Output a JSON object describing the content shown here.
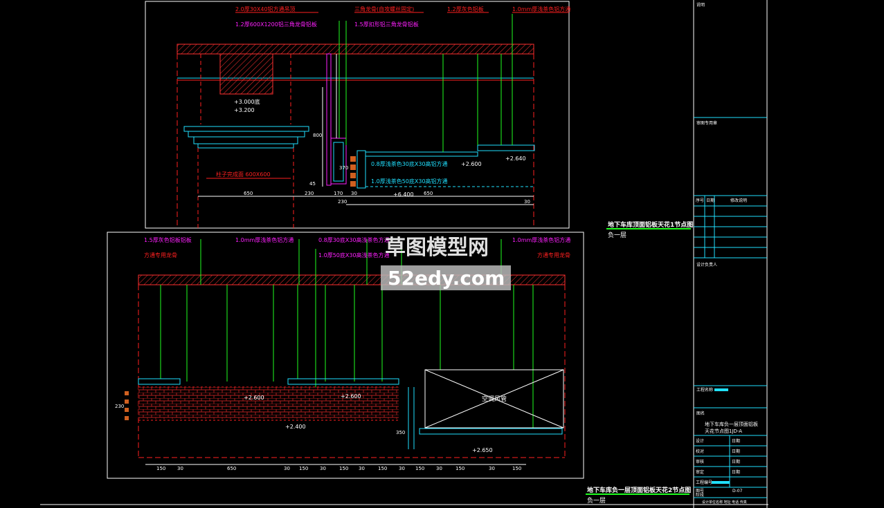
{
  "colors": {
    "background": "#000000",
    "frame": "#ffffff",
    "red": "#ff2020",
    "green": "#20ff20",
    "cyan": "#20e0ff",
    "magenta": "#ff20ff",
    "yellow": "#ffff20",
    "hatch": "#ff3030",
    "panel": "#20e0ff",
    "watermark_bg": "#cccccc"
  },
  "detail1": {
    "labels_top": [
      "2.0厚30X40铝方通吊顶",
      "1.2厚600X1200铝三角龙骨铝板",
      "三角龙骨(自攻螺丝固定)",
      "1.5厚扣形铝三角龙骨铝板",
      "1.2厚灰色铝板",
      "1.0mm厚浅茶色铝方通"
    ],
    "level_labels": [
      "+3.000底",
      "+3.200"
    ],
    "column_label": "柱子完成面 600X600",
    "right_labels": [
      "0.8厚浅茶色30底X30高铝方通",
      "1.0厚浅茶色50底X30高铝方通"
    ],
    "elevations": [
      "+2.600",
      "+2.640",
      "+6.400"
    ],
    "dims_bottom": [
      "650",
      "230",
      "170",
      "30",
      "650",
      "30",
      "230"
    ],
    "dim_vertical": [
      "800",
      "370",
      "45"
    ]
  },
  "detail2": {
    "labels_top": [
      "1.5厚灰色铝板铝板",
      "方通专用龙骨",
      "1.0mm厚浅茶色铝方通",
      "0.8厚30底X30高浅茶色方通",
      "1.0厚50底X30高浅茶色方通",
      "1.0mm厚浅茶色铝方通",
      "方通专用龙骨"
    ],
    "elevations": [
      "+2.600",
      "+2.600",
      "+2.400",
      "+2.650"
    ],
    "vent_label": "空调风管",
    "dims_bottom": [
      "150",
      "30",
      "650",
      "30",
      "150",
      "30",
      "150",
      "30",
      "150",
      "30",
      "150",
      "30",
      "150",
      "30",
      "150"
    ],
    "dim_vertical": [
      "230",
      "350"
    ]
  },
  "titles": {
    "detail1_title": "地下车库顶面铝板天花1节点图",
    "detail1_sub": "负一层",
    "detail2_title": "地下车库负一层顶面铝板天花2节点图",
    "detail2_sub": "负一层"
  },
  "title_block": {
    "header": "说明",
    "stamp": "审图专用章",
    "revision_cols": [
      "序号",
      "日期",
      "修改说明"
    ],
    "signature": "设计负责人",
    "project_label": "工程名称",
    "drawing_label": "图名",
    "drawing_name_line1": "地下车库负一层顶面铝板",
    "drawing_name_line2": "天花节点图1JD-A",
    "roles": [
      "设计",
      "校对",
      "审核",
      "审定"
    ],
    "date_label": "日期",
    "project_no_label": "工程编号",
    "sheet_label": "图号",
    "sheet_no": "D-07",
    "phase_label": "阶段",
    "footer": "设计单位名称 地址 电话 传真"
  },
  "watermark": {
    "line1": "草图模型网",
    "line2": "52edy.com"
  }
}
